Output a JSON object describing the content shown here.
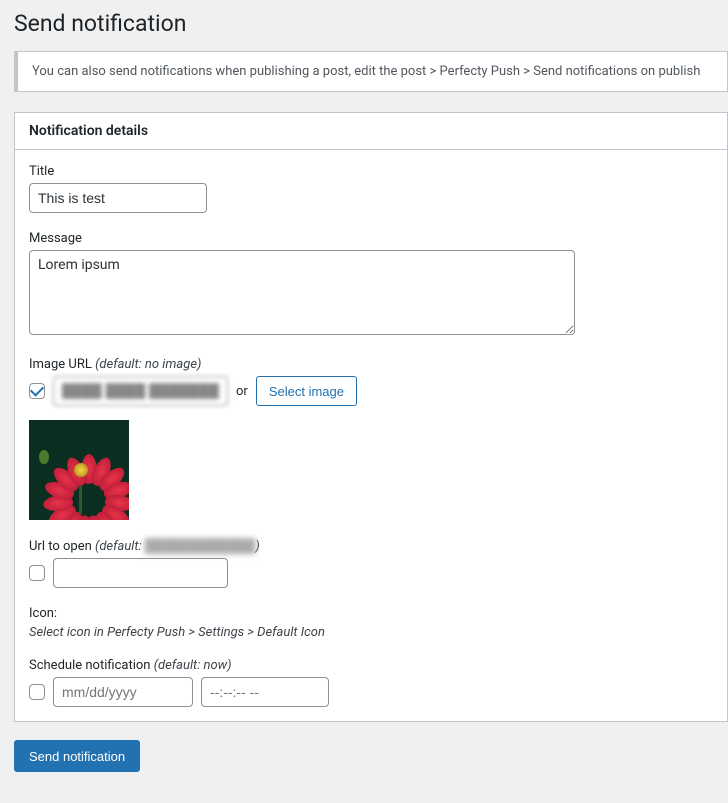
{
  "page_title": "Send notification",
  "notice": "You can also send notifications when publishing a post, edit the post > Perfecty Push > Send notifications on publish",
  "panel_header": "Notification details",
  "title": {
    "label": "Title",
    "value": "This is test"
  },
  "message": {
    "label": "Message",
    "value": "Lorem ipsum"
  },
  "image_url": {
    "label": "Image URL ",
    "hint": "(default: no image)",
    "checked": true,
    "value": "████ ████ ████████",
    "or_text": "or",
    "select_button": "Select image"
  },
  "url_to_open": {
    "label": "Url to open ",
    "hint_prefix": "(default: ",
    "hint_blurred": "████████████",
    "hint_suffix": ")",
    "checked": false,
    "value": ""
  },
  "icon": {
    "label": "Icon:",
    "help": "Select icon in Perfecty Push > Settings > Default Icon"
  },
  "schedule": {
    "label": "Schedule notification ",
    "hint": "(default: now)",
    "checked": false,
    "date_placeholder": "mm/dd/yyyy",
    "time_placeholder": "--:--:-- --"
  },
  "submit_button": "Send notification"
}
